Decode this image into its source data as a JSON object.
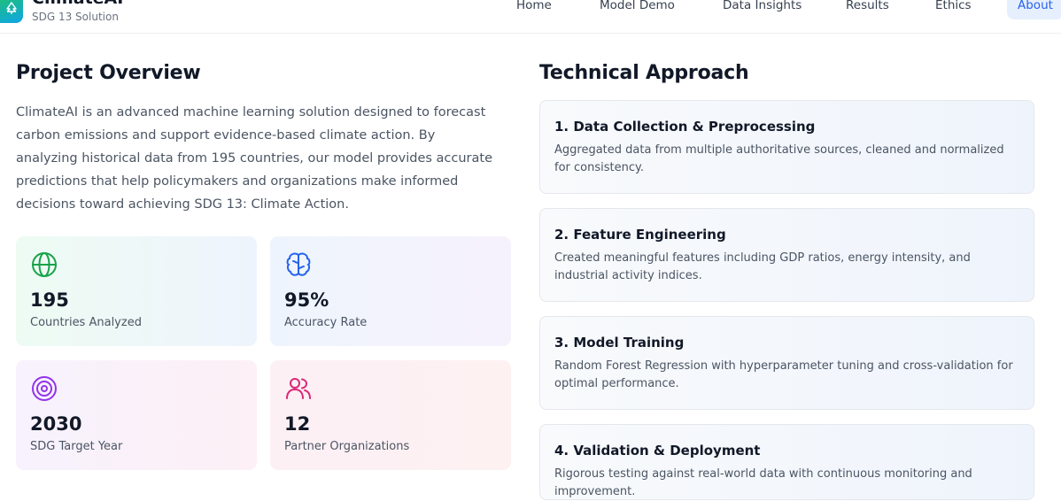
{
  "brand": {
    "name": "ClimateAI",
    "subtitle": "SDG 13 Solution"
  },
  "nav": {
    "items": [
      {
        "label": "Home"
      },
      {
        "label": "Model Demo"
      },
      {
        "label": "Data Insights"
      },
      {
        "label": "Results"
      },
      {
        "label": "Ethics"
      },
      {
        "label": "About",
        "active": true
      }
    ]
  },
  "overview": {
    "title": "Project Overview",
    "text": "ClimateAI is an advanced machine learning solution designed to forecast carbon emissions and support evidence-based climate action. By analyzing historical data from 195 countries, our model provides accurate predictions that help policymakers and organizations make informed decisions toward achieving SDG 13: Climate Action.",
    "stats": [
      {
        "value": "195",
        "label": "Countries Analyzed",
        "icon": "globe-icon",
        "color": "#16a34a"
      },
      {
        "value": "95%",
        "label": "Accuracy Rate",
        "icon": "brain-icon",
        "color": "#2563eb"
      },
      {
        "value": "2030",
        "label": "SDG Target Year",
        "icon": "target-icon",
        "color": "#9333ea"
      },
      {
        "value": "12",
        "label": "Partner Organizations",
        "icon": "users-icon",
        "color": "#db2777"
      }
    ]
  },
  "approach": {
    "title": "Technical Approach",
    "steps": [
      {
        "title": "1. Data Collection & Preprocessing",
        "desc": "Aggregated data from multiple authoritative sources, cleaned and normalized for consistency."
      },
      {
        "title": "2. Feature Engineering",
        "desc": "Created meaningful features including GDP ratios, energy intensity, and industrial activity indices."
      },
      {
        "title": "3. Model Training",
        "desc": "Random Forest Regression with hyperparameter tuning and cross-validation for optimal performance."
      },
      {
        "title": "4. Validation & Deployment",
        "desc": "Rigorous testing against real-world data with continuous monitoring and improvement."
      }
    ]
  }
}
